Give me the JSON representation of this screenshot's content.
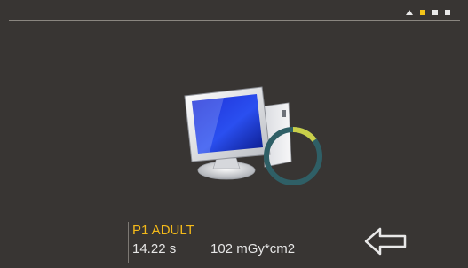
{
  "header": {
    "page_indicator": {
      "icons": [
        "home-icon",
        "page-dot",
        "page-dot",
        "page-dot"
      ],
      "active_index": 1
    }
  },
  "status": {
    "illustration": "computer-monitor-icon",
    "progress_ring": 0.13
  },
  "exam": {
    "protocol": "P1 ADULT",
    "time": "14.22 s",
    "dose": "102 mGy*cm2"
  },
  "controls": {
    "back_icon": "arrow-left-icon"
  },
  "colors": {
    "background": "#383533",
    "accent_yellow": "#f3c419",
    "text": "#e6e6e6",
    "ring_track": "#2f5f66"
  }
}
